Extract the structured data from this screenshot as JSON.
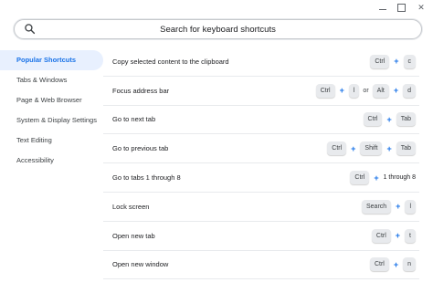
{
  "search": {
    "placeholder": "Search for keyboard shortcuts"
  },
  "sidebar": {
    "items": [
      {
        "label": "Popular Shortcuts",
        "active": true
      },
      {
        "label": "Tabs & Windows",
        "active": false
      },
      {
        "label": "Page & Web Browser",
        "active": false
      },
      {
        "label": "System & Display Settings",
        "active": false
      },
      {
        "label": "Text Editing",
        "active": false
      },
      {
        "label": "Accessibility",
        "active": false
      }
    ]
  },
  "shortcuts": [
    {
      "desc": "Copy selected content to the clipboard",
      "k1": "Ctrl",
      "k2": "c"
    },
    {
      "desc": "Focus address bar",
      "k1": "Ctrl",
      "k2": "l",
      "or": "or",
      "k3": "Alt",
      "k4": "d"
    },
    {
      "desc": "Go to next tab",
      "k1": "Ctrl",
      "k2": "Tab"
    },
    {
      "desc": "Go to previous tab",
      "k1": "Ctrl",
      "k2": "Shift",
      "k3": "Tab"
    },
    {
      "desc": "Go to tabs 1 through 8",
      "k1": "Ctrl",
      "suffix": "1 through 8"
    },
    {
      "desc": "Lock screen",
      "k1": "Search",
      "k2": "l"
    },
    {
      "desc": "Open new tab",
      "k1": "Ctrl",
      "k2": "t"
    },
    {
      "desc": "Open new window",
      "k1": "Ctrl",
      "k2": "n"
    }
  ],
  "colors": {
    "accent": "#1a73e8",
    "active_bg": "#e8f0fe",
    "key_bg": "#e8eaed"
  }
}
